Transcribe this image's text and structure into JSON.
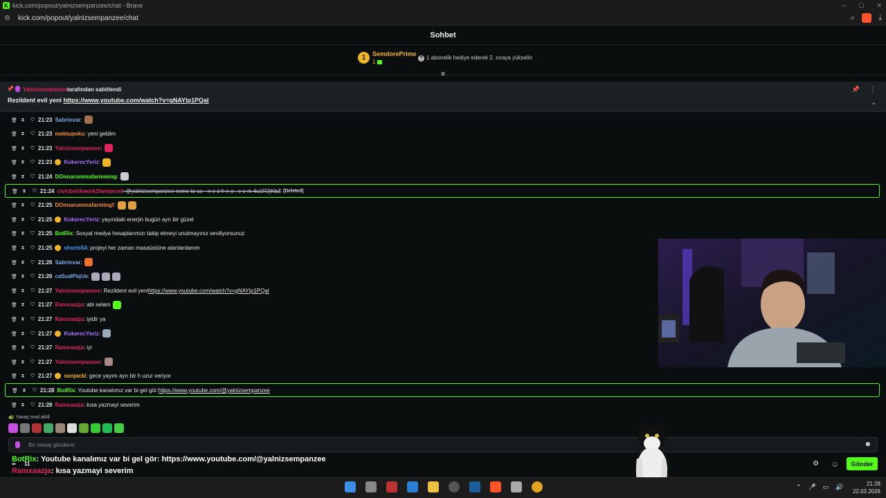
{
  "browser": {
    "title": "kick.com/popout/yalnizsempanzee/chat - Brave",
    "url": "kick.com/popout/yalnizsempanzee/chat"
  },
  "chat": {
    "header": "Sohbet",
    "gift": {
      "rank": "1",
      "user": "SemdorePrime",
      "count": "1",
      "info": "1 abonelik hediye ederek 2. sıraya yükselin"
    },
    "pinned": {
      "user": "Yalnizsempanzee",
      "by_text": "tarafından sabitlendi",
      "text": "Rezildent evil yeni ",
      "link": "https://www.youtube.com/watch?v=gNAYIp1PQaI"
    },
    "messages": [
      {
        "time": "21:23",
        "user": "Sabrinvar",
        "text": ": ",
        "color": "#7ea9e8"
      },
      {
        "time": "21:23",
        "user": "mektupoku",
        "text": ": yeni geldim",
        "color": "#f48c37"
      },
      {
        "time": "21:23",
        "user": "Yalnizsempanzee",
        "text": ": ",
        "color": "#e0245e"
      },
      {
        "time": "21:23",
        "user": "KokerecYeriz",
        "text": ": ",
        "color": "#a970ff"
      },
      {
        "time": "21:24",
        "user": "DOnnarummafarmming",
        "text": ": ",
        "color": "#53fc18"
      },
      {
        "time": "21:24",
        "user": "civicbrickwork1fwmpcml",
        "text": ": @yalnizsempanzee come to us - n e z h n a . c o m 4u1R2jKbZ",
        "deleted": "(Deleted)",
        "color": "#e0245e"
      },
      {
        "time": "21:25",
        "user": "DOnnarummafarmingf",
        "text": ": ",
        "color": "#f48c37"
      },
      {
        "time": "21:25",
        "user": "KokerecYeriz",
        "text": ": yayındaki enerjin bugün ayrı bir güzel",
        "color": "#a970ff"
      },
      {
        "time": "21:25",
        "user": "BotRix",
        "text": ": Sosyal medya hesaplarımızı takip etmeyi unutmayınız seviliyorsunuz",
        "color": "#53fc18"
      },
      {
        "time": "21:25",
        "user": "shorts54",
        "text": ": projeyi her zaman masaüstüne atanlardanım",
        "color": "#3aa0ff"
      },
      {
        "time": "21:26",
        "user": "Sabrinvar",
        "text": ": ",
        "color": "#7ea9e8"
      },
      {
        "time": "21:26",
        "user": "ca5ualPiqUe",
        "text": ": ",
        "color": "#7ea9e8"
      },
      {
        "time": "21:27",
        "user": "Yalnizsempanzee",
        "text": ": Rezildent evil yeni ",
        "link": "https://www.youtube.com/watch?v=gNAYIp1PQaI",
        "color": "#e0245e"
      },
      {
        "time": "21:27",
        "user": "Ramxaazja",
        "text": ": abi selam ",
        "color": "#e0245e"
      },
      {
        "time": "21:27",
        "user": "Ramxaazja",
        "text": ": iyidir ya",
        "color": "#e0245e"
      },
      {
        "time": "21:27",
        "user": "KokerecYeriz",
        "text": ": ",
        "color": "#a970ff"
      },
      {
        "time": "21:27",
        "user": "Ramxaazja",
        "text": ": iyi",
        "color": "#e0245e"
      },
      {
        "time": "21:27",
        "user": "Yalnizsempanzee",
        "text": ": ",
        "color": "#e0245e"
      },
      {
        "time": "21:27",
        "user": "sonjacki",
        "text": ": gece yayını ayrı bir h  uzur veriyor",
        "color": "#f0b429"
      },
      {
        "time": "21:28",
        "user": "BotRix",
        "text": ": Youtube kanalımız var bi gel gör: ",
        "link": "https://www.youtube.com/@yalnizsempanzee",
        "color": "#53fc18"
      },
      {
        "time": "21:28",
        "user": "Ramxaazja",
        "text": ": kısa yazmayi severim",
        "color": "#e0245e"
      }
    ],
    "slow_mode": "Yavaş mod aktif",
    "input_placeholder": "Bir mesaj gönderin",
    "send_label": "Gönder"
  },
  "overlay": {
    "line1_user": "BotRix",
    "line1_text": ": Youtube kanalımız var bi gel gör: https://www.youtube.com/@yalnizsempanzee",
    "line2_user": "Ramxaazja",
    "line2_text": ": kısa yazmayi severim",
    "viewers": "11"
  },
  "taskbar": {
    "time": "21:28",
    "date": "22.03.2026"
  },
  "colors": {
    "accent": "#53fc18",
    "pinned_bg": "#1b2022",
    "background": "#0b0e0f"
  }
}
